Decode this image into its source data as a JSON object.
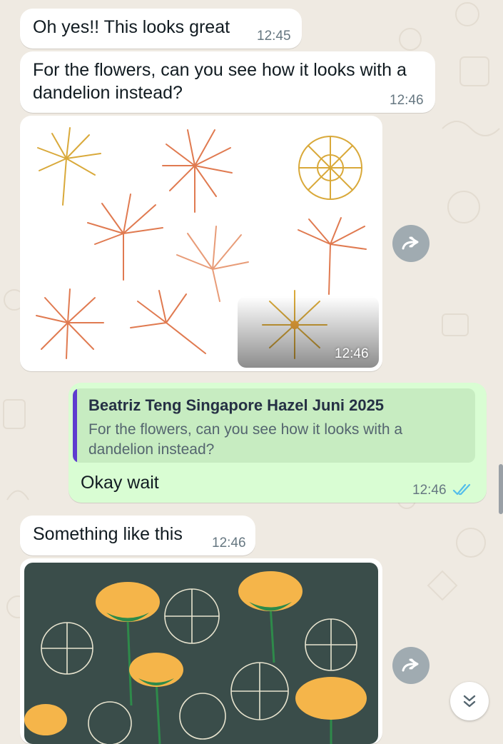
{
  "messages": [
    {
      "text": "Oh yes!! This looks great",
      "time": "12:45"
    },
    {
      "text": "For the flowers, can you see how it looks with a dandelion instead?",
      "time": "12:46"
    },
    {
      "image_alt": "dandelion illustrations",
      "time": "12:46"
    },
    {
      "reply_to": {
        "author": "Beatriz Teng Singapore Hazel Juni 2025",
        "text": "For the flowers, can you see how it looks with a dandelion instead?"
      },
      "text": "Okay wait",
      "time": "12:46",
      "status": "read"
    },
    {
      "text": "Something like this",
      "time": "12:46"
    },
    {
      "image_alt": "dandelion and yellow flower pattern"
    }
  ],
  "icons": {
    "forward": "forward-icon",
    "read_receipt": "double-check-icon",
    "scroll_down": "chevron-down-icon"
  },
  "colors": {
    "incoming_bubble": "#ffffff",
    "outgoing_bubble": "#d9fdd3",
    "quote_bar": "#5e3ccf",
    "read_tick": "#53bdeb",
    "chat_background": "#efeae2"
  }
}
